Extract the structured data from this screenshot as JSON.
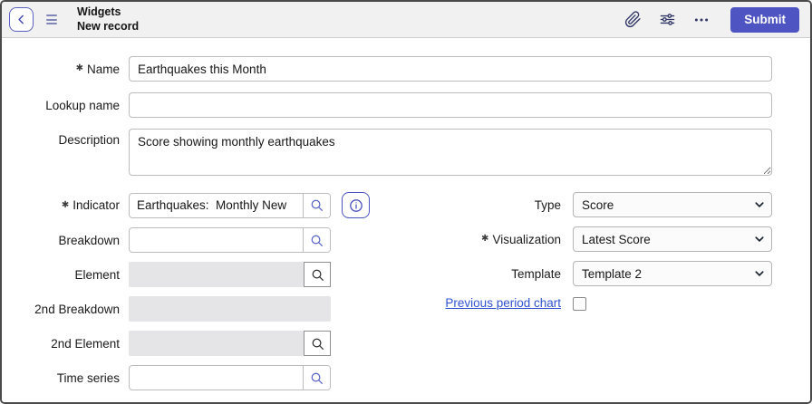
{
  "header": {
    "title_line1": "Widgets",
    "title_line2": "New record",
    "submit_label": "Submit",
    "icons": [
      "chevron-left-icon",
      "hamburger-icon",
      "paperclip-icon",
      "sliders-icon",
      "more-ellipsis-icon"
    ]
  },
  "required_marker": "✱",
  "fields": {
    "name": {
      "label": "Name",
      "value": "Earthquakes this Month",
      "required": true
    },
    "lookup_name": {
      "label": "Lookup name",
      "value": ""
    },
    "description": {
      "label": "Description",
      "value": "Score showing monthly earthquakes"
    },
    "indicator": {
      "label": "Indicator",
      "value": "Earthquakes:  Monthly New",
      "required": true,
      "icons": [
        "search-icon",
        "info-icon"
      ]
    },
    "breakdown": {
      "label": "Breakdown",
      "value": "",
      "icons": [
        "search-icon"
      ]
    },
    "element": {
      "label": "Element",
      "value": "",
      "disabled": true,
      "icons": [
        "search-icon"
      ]
    },
    "second_breakdown": {
      "label": "2nd Breakdown",
      "value": "",
      "disabled": true
    },
    "second_element": {
      "label": "2nd Element",
      "value": "",
      "disabled": true,
      "icons": [
        "search-icon"
      ]
    },
    "time_series": {
      "label": "Time series",
      "value": "",
      "icons": [
        "search-icon"
      ]
    },
    "type": {
      "label": "Type",
      "value": "Score"
    },
    "visualization": {
      "label": "Visualization",
      "value": "Latest Score",
      "required": true
    },
    "template": {
      "label": "Template",
      "value": "Template 2"
    },
    "previous_period_chart": {
      "label": "Previous period chart",
      "checked": false
    }
  },
  "colors": {
    "accent": "#4e54c2",
    "link": "#3052d0",
    "header_bg": "#f1f1f1",
    "disabled_bg": "#e5e5e7",
    "input_border": "#bcbcbc",
    "icon_dark": "#2f3564"
  }
}
